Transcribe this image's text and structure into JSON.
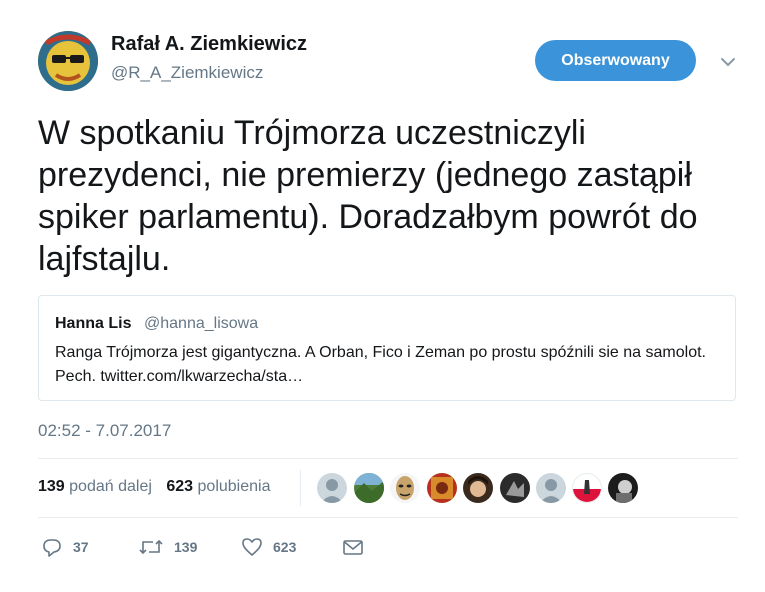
{
  "author": {
    "display_name": "Rafał A. Ziemkiewicz",
    "handle": "@R_A_Ziemkiewicz",
    "avatar_icon": "profile-avatar"
  },
  "follow_button": {
    "label": "Obserwowany",
    "color": "#3b94d9"
  },
  "menu": {
    "icon": "chevron-down-icon"
  },
  "tweet": {
    "text": "W spotkaniu Trójmorza uczestniczyli\nprezydenci, nie premierzy (jednego zastąpił\nspiker parlamentu). Doradzałbym powrót do\nlajfstajlu."
  },
  "quoted_tweet": {
    "name": "Hanna Lis",
    "handle": "@hanna_lisowa",
    "text": "Ranga Trójmorza jest gigantyczna. A Orban, Fico i Zeman po prostu spóźnili sie na samolot. Pech. twitter.com/lkwarzecha/sta…"
  },
  "timestamp": "02:52 - 7.07.2017",
  "stats": {
    "retweets_count": "139",
    "retweets_label": "podań dalej",
    "likes_count": "623",
    "likes_label": "polubienia"
  },
  "likers": [
    {
      "name": "liker-avatar-default-1"
    },
    {
      "name": "liker-avatar-landscape"
    },
    {
      "name": "liker-avatar-mask"
    },
    {
      "name": "liker-avatar-painting"
    },
    {
      "name": "liker-avatar-person"
    },
    {
      "name": "liker-avatar-dark"
    },
    {
      "name": "liker-avatar-default-2"
    },
    {
      "name": "liker-avatar-flag"
    },
    {
      "name": "liker-avatar-bw"
    }
  ],
  "actions": {
    "reply_count": "37",
    "retweet_count": "139",
    "like_count": "623"
  },
  "colors": {
    "text_primary": "#14171a",
    "text_secondary": "#657786",
    "border": "#e1e8ed"
  }
}
